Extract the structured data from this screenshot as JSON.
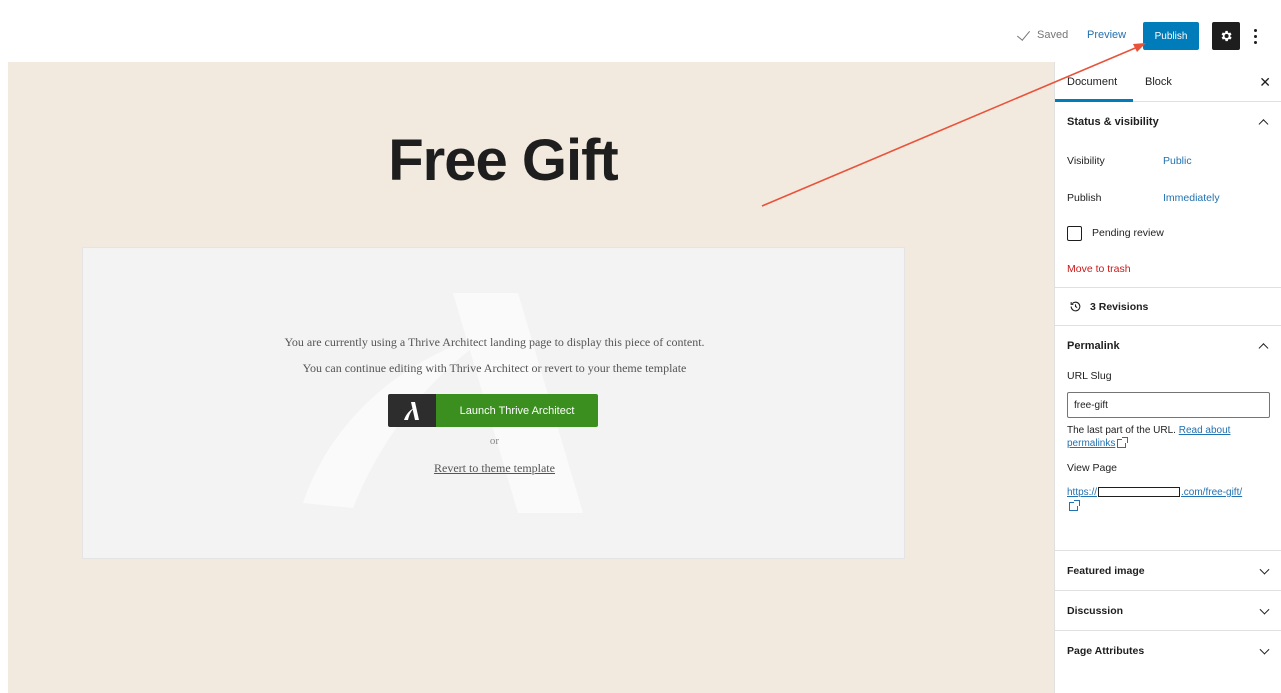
{
  "topbar": {
    "saved_label": "Saved",
    "preview_label": "Preview",
    "publish_label": "Publish",
    "settings_icon": "gear-icon",
    "more_icon": "vertical-ellipsis-icon"
  },
  "editor": {
    "post_title": "Free Gift",
    "notice_line1": "You are currently using a Thrive Architect landing page to display this piece of content.",
    "notice_line2": "You can continue editing with Thrive Architect or revert to your theme template",
    "launch_label": "Launch Thrive Architect",
    "or_text": "or",
    "revert_label": "Revert to theme template"
  },
  "sidebar": {
    "tabs": [
      {
        "label": "Document",
        "active": true
      },
      {
        "label": "Block",
        "active": false
      }
    ],
    "status_panel": {
      "title": "Status & visibility",
      "visibility_label": "Visibility",
      "visibility_value": "Public",
      "publish_label": "Publish",
      "publish_value": "Immediately",
      "pending_label": "Pending review",
      "pending_checked": false,
      "trash_label": "Move to trash"
    },
    "revisions_label": "3 Revisions",
    "permalink": {
      "title": "Permalink",
      "slug_label": "URL Slug",
      "slug_value": "free-gift",
      "help_text": "The last part of the URL.",
      "help_link": "Read about permalinks",
      "view_page_label": "View Page",
      "url_prefix": "https://",
      "url_suffix": ".com/free-gift/"
    },
    "panels": [
      "Featured image",
      "Discussion",
      "Page Attributes"
    ]
  },
  "colors": {
    "accent": "#007cba",
    "canvas_bg": "#f2e9df",
    "launch_green": "#3a8f1f",
    "trash_red": "#cc1818",
    "annotation_arrow": "#e8533a"
  }
}
